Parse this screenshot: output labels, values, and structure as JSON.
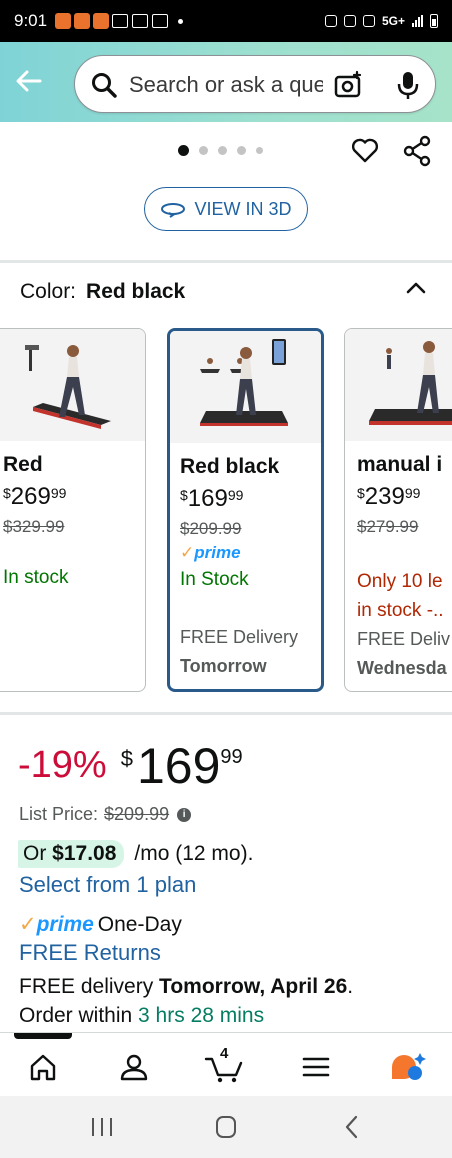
{
  "status_bar": {
    "time": "9:01",
    "network": "5G+"
  },
  "header": {
    "search_placeholder": "Search or ask a question"
  },
  "carousel": {
    "dot_count": 5,
    "active_index": 0
  },
  "view_3d_label": "VIEW IN 3D",
  "color_section": {
    "label": "Color:",
    "selected": "Red black"
  },
  "variants": [
    {
      "name": "Red",
      "currency": "$",
      "whole": "269",
      "cents": "99",
      "list_price": "$329.99",
      "prime": false,
      "stock": "In stock",
      "stock_color": "green"
    },
    {
      "name": "Red black",
      "currency": "$",
      "whole": "169",
      "cents": "99",
      "list_price": "$209.99",
      "prime": true,
      "prime_text": "prime",
      "stock": "In Stock",
      "stock_color": "green",
      "delivery_line1": "FREE Delivery",
      "delivery_line2": "Tomorrow"
    },
    {
      "name": "manual i",
      "currency": "$",
      "whole": "239",
      "cents": "99",
      "list_price": "$279.99",
      "prime": false,
      "stock_line1": "Only 10 le",
      "stock_line2": "in stock -..",
      "stock_color": "red",
      "delivery_line1": "FREE Deliv",
      "delivery_line2": "Wednesda"
    }
  ],
  "price": {
    "discount": "-19%",
    "currency": "$",
    "whole": "169",
    "cents": "99",
    "list_label": "List Price:",
    "list_value": "$209.99",
    "info_icon": "i",
    "monthly_prefix": "Or",
    "monthly_amount": "$17.08",
    "monthly_suffix": "/mo (12 mo).",
    "select_plan": "Select from 1 plan",
    "prime_word": "prime",
    "one_day": "One-Day",
    "free_returns": "FREE Returns",
    "delivery_prefix": "FREE delivery",
    "delivery_date": "Tomorrow, April 26",
    "delivery_end": ".",
    "order_prefix": "Order within",
    "order_time": "3 hrs 28 mins"
  },
  "bottom_nav": {
    "cart_count": "4",
    "items": [
      "home-icon",
      "account-icon",
      "cart-icon",
      "menu-icon",
      "rufus-icon"
    ]
  },
  "colors": {
    "accent_blue": "#2162a1",
    "discount_red": "#cc0c39",
    "stock_green": "#007600",
    "prime_blue": "#1a98ff",
    "header_teal": "#7fd3d6"
  }
}
